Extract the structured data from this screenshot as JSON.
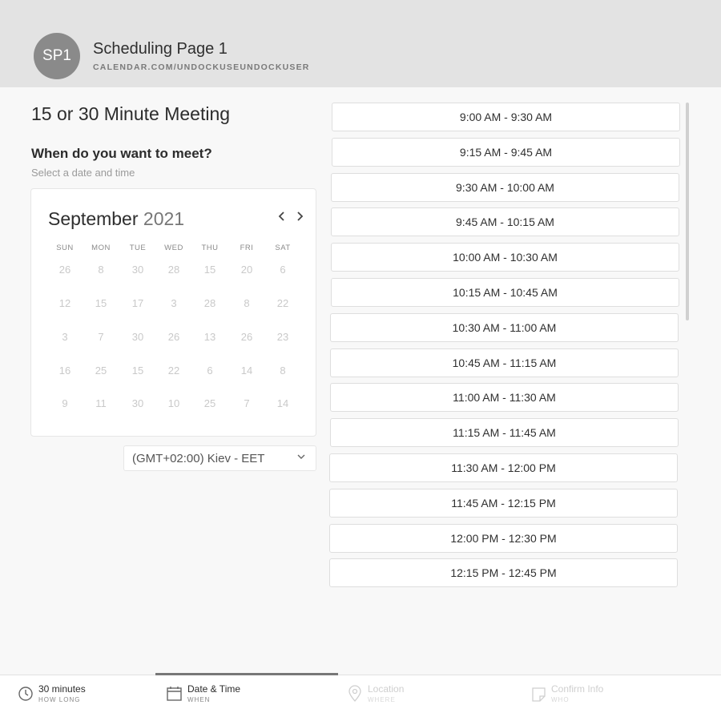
{
  "header": {
    "avatar_text": "SP1",
    "page_name": "Scheduling Page 1",
    "page_url": "CALENDAR.COM/UNDOCKUSEUNDOCKUSER"
  },
  "meeting": {
    "title": "15 or 30 Minute Meeting",
    "section_title": "When do you want to meet?",
    "section_subtitle": "Select a date and time"
  },
  "calendar": {
    "month": "September",
    "year": "2021",
    "prev_icon": "chevron-left-icon",
    "next_icon": "chevron-right-icon",
    "weekdays": [
      "SUN",
      "MON",
      "TUE",
      "WED",
      "THU",
      "FRI",
      "SAT"
    ],
    "weeks": [
      [
        "26",
        "8",
        "30",
        "28",
        "15",
        "20",
        "6"
      ],
      [
        "12",
        "15",
        "17",
        "3",
        "28",
        "8",
        "22"
      ],
      [
        "3",
        "7",
        "30",
        "26",
        "13",
        "26",
        "23"
      ],
      [
        "16",
        "25",
        "15",
        "22",
        "6",
        "14",
        "8"
      ],
      [
        "9",
        "11",
        "30",
        "10",
        "25",
        "7",
        "14"
      ]
    ]
  },
  "timezone": {
    "value": "(GMT+02:00) Kiev - EET",
    "icon": "chevron-down-icon"
  },
  "time_slots": [
    "9:00 AM - 9:30 AM",
    "9:15 AM - 9:45 AM",
    "9:30 AM - 10:00 AM",
    "9:45 AM - 10:15 AM",
    "10:00 AM - 10:30 AM",
    "10:15 AM - 10:45 AM",
    "10:30 AM - 11:00 AM",
    "10:45 AM - 11:15 AM",
    "11:00 AM - 11:30 AM",
    "11:15 AM - 11:45 AM",
    "11:30 AM - 12:00 PM",
    "11:45 AM - 12:15 PM",
    "12:00 PM - 12:30 PM",
    "12:15 PM - 12:45 PM"
  ],
  "steps": [
    {
      "label": "30 minutes",
      "sub": "HOW LONG",
      "icon": "clock-icon",
      "state": "active"
    },
    {
      "label": "Date & Time",
      "sub": "WHEN",
      "icon": "calendar-icon",
      "state": "active"
    },
    {
      "label": "Location",
      "sub": "WHERE",
      "icon": "location-pin-icon",
      "state": "inactive"
    },
    {
      "label": "Confirm Info",
      "sub": "WHO",
      "icon": "note-icon",
      "state": "inactive"
    }
  ],
  "colors": {
    "header_bg": "#e3e3e3",
    "avatar_bg": "#8a8a8a",
    "page_bg": "#f8f8f8",
    "progress": "#777777"
  }
}
